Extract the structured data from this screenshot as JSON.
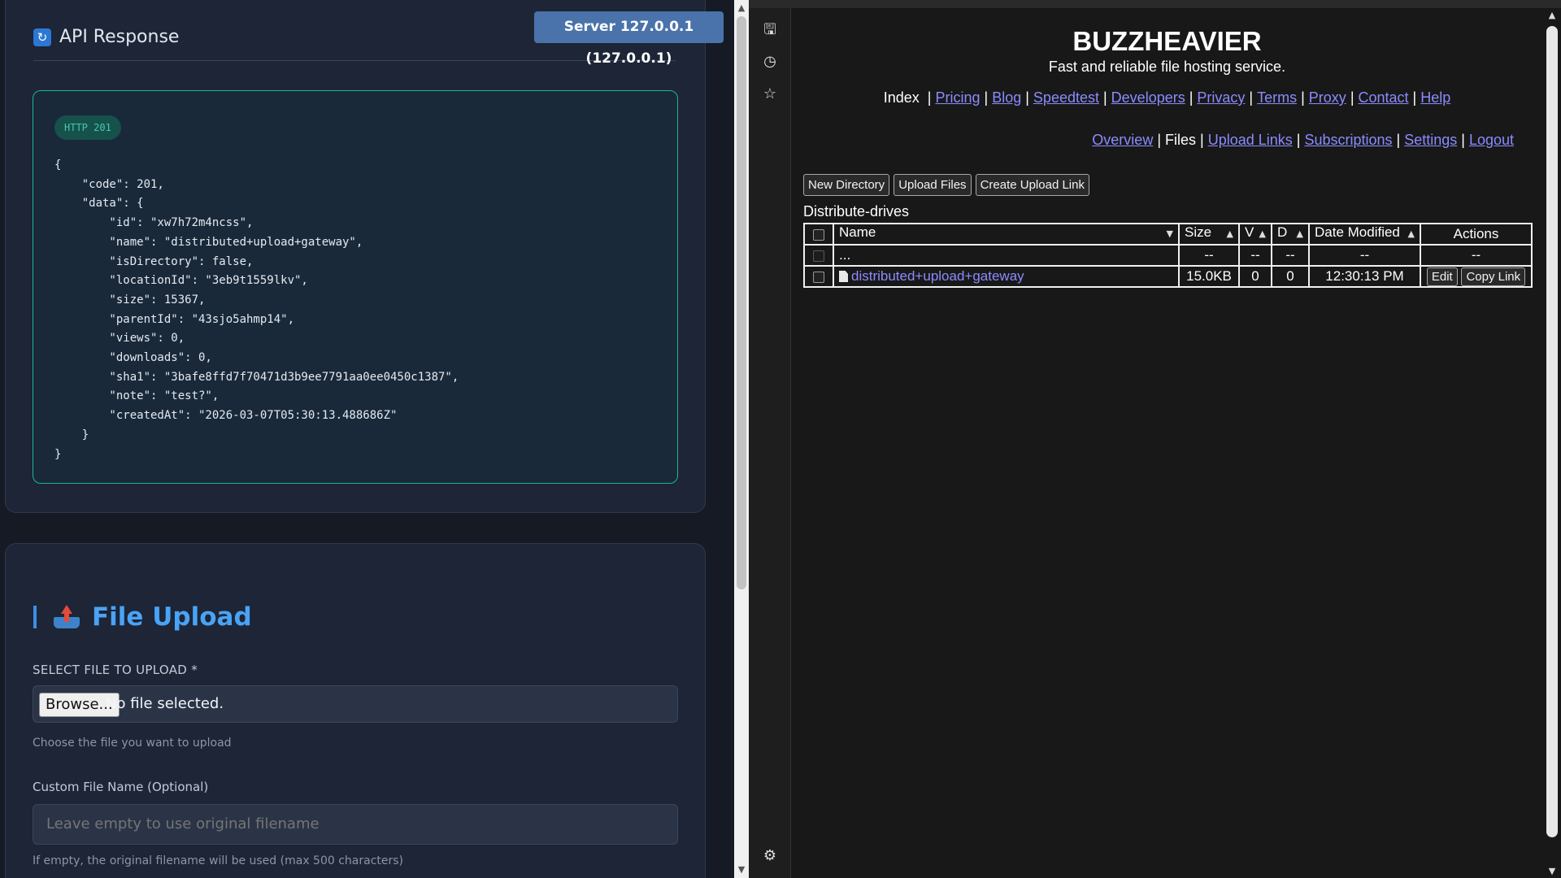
{
  "left": {
    "server_badge": "Server 127.0.0.1 (127.0.0.1)",
    "api_response": {
      "icon": "refresh-icon",
      "title": "API Response",
      "status_badge": "HTTP 201",
      "json_lines": [
        "{",
        "    \"code\": 201,",
        "    \"data\": {",
        "        \"id\": \"xw7h72m4ncss\",",
        "        \"name\": \"distributed+upload+gateway\",",
        "        \"isDirectory\": false,",
        "        \"locationId\": \"3eb9t1559lkv\",",
        "        \"size\": 15367,",
        "        \"parentId\": \"43sjo5ahmp14\",",
        "        \"views\": 0,",
        "        \"downloads\": 0,",
        "        \"sha1\": \"3bafe8ffd7f70471d3b9ee7791aa0ee0450c1387\",",
        "        \"note\": \"test?\",",
        "        \"createdAt\": \"2026-03-07T05:30:13.488686Z\"",
        "    }",
        "}"
      ]
    },
    "file_upload": {
      "title": "File Upload",
      "icon": "upload-tray-icon",
      "select_label": "SELECT FILE TO UPLOAD *",
      "browse_label": "Browse...",
      "no_file_text": "No file selected.",
      "select_hint": "Choose the file you want to upload",
      "custom_name_label": "Custom File Name (Optional)",
      "custom_name_placeholder": "Leave empty to use original filename",
      "custom_name_hint": "If empty, the original filename will be used (max 500 characters)"
    }
  },
  "browser_sidebar": {
    "icons": [
      "save-page-icon",
      "history-icon",
      "star-icon",
      "settings-gear-icon"
    ]
  },
  "right": {
    "site_title": "BUZZHEAVIER",
    "tagline": "Fast and reliable file hosting service.",
    "main_nav": {
      "current": "Index",
      "links": [
        "Pricing",
        "Blog",
        "Speedtest",
        "Developers",
        "Privacy",
        "Terms",
        "Proxy",
        "Contact",
        "Help"
      ]
    },
    "sub_nav": {
      "items": [
        {
          "label": "Overview",
          "link": true
        },
        {
          "label": "Files",
          "link": false
        },
        {
          "label": "Upload Links",
          "link": true
        },
        {
          "label": "Subscriptions",
          "link": true
        },
        {
          "label": "Settings",
          "link": true
        },
        {
          "label": "Logout",
          "link": true
        }
      ]
    },
    "actions": {
      "new_directory": "New Directory",
      "upload_files": "Upload Files",
      "create_upload_link": "Create Upload Link"
    },
    "directory_name": "Distribute-drives",
    "table": {
      "headers": {
        "name": "Name",
        "size": "Size",
        "views": "V",
        "downloads": "D",
        "date_modified": "Date Modified",
        "actions": "Actions"
      },
      "parent_row": {
        "name": "...",
        "size": "--",
        "views": "--",
        "downloads": "--",
        "date_modified": "--",
        "actions": "--"
      },
      "rows": [
        {
          "name": "distributed+upload+gateway",
          "size": "15.0KB",
          "views": "0",
          "downloads": "0",
          "date_modified": "12:30:13 PM",
          "edit_label": "Edit",
          "copy_label": "Copy Link"
        }
      ]
    }
  },
  "colors": {
    "accent_blue": "#4aa3f5",
    "response_border": "#1fb394",
    "link": "#8b8bff",
    "server_badge_bg": "#4a73ab"
  }
}
